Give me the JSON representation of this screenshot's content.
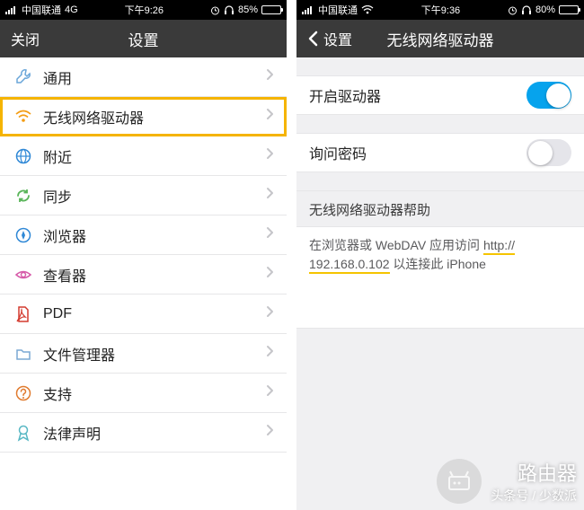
{
  "left": {
    "status": {
      "carrier": "中国联通",
      "network": "4G",
      "time": "下午9:26",
      "battery_pct": "85%",
      "battery_fill": 85
    },
    "nav": {
      "close": "关闭",
      "title": "设置"
    },
    "items": [
      {
        "icon": "wrench",
        "label": "通用",
        "color": "#6aa6d9"
      },
      {
        "icon": "wifi",
        "label": "无线网络驱动器",
        "color": "#f39c12",
        "highlight": true
      },
      {
        "icon": "globe",
        "label": "附近",
        "color": "#2f88d6"
      },
      {
        "icon": "sync",
        "label": "同步",
        "color": "#5ab55a"
      },
      {
        "icon": "compass",
        "label": "浏览器",
        "color": "#2f88d6"
      },
      {
        "icon": "eye",
        "label": "查看器",
        "color": "#d65aa8"
      },
      {
        "icon": "pdf",
        "label": "PDF",
        "color": "#d33a2f"
      },
      {
        "icon": "folder",
        "label": "文件管理器",
        "color": "#7aa8d4"
      },
      {
        "icon": "help",
        "label": "支持",
        "color": "#e07b2f"
      },
      {
        "icon": "ribbon",
        "label": "法律声明",
        "color": "#58b8c4"
      }
    ]
  },
  "right": {
    "status": {
      "carrier": "中国联通",
      "network": "wifi",
      "time": "下午9:36",
      "battery_pct": "80%",
      "battery_fill": 80
    },
    "nav": {
      "back": "设置",
      "title": "无线网络驱动器"
    },
    "toggles": {
      "enable_label": "开启驱动器",
      "enable_on": true,
      "ask_pwd_label": "询问密码",
      "ask_pwd_on": false
    },
    "help_header": "无线网络驱动器帮助",
    "help_pre": "在浏览器或 WebDAV 应用访问 ",
    "help_url_a": "http://",
    "help_url_b": "192.168.0.102",
    "help_post": " 以连接此 iPhone"
  },
  "watermark": {
    "big": "路由器",
    "small": "头条号 / 少数派"
  }
}
